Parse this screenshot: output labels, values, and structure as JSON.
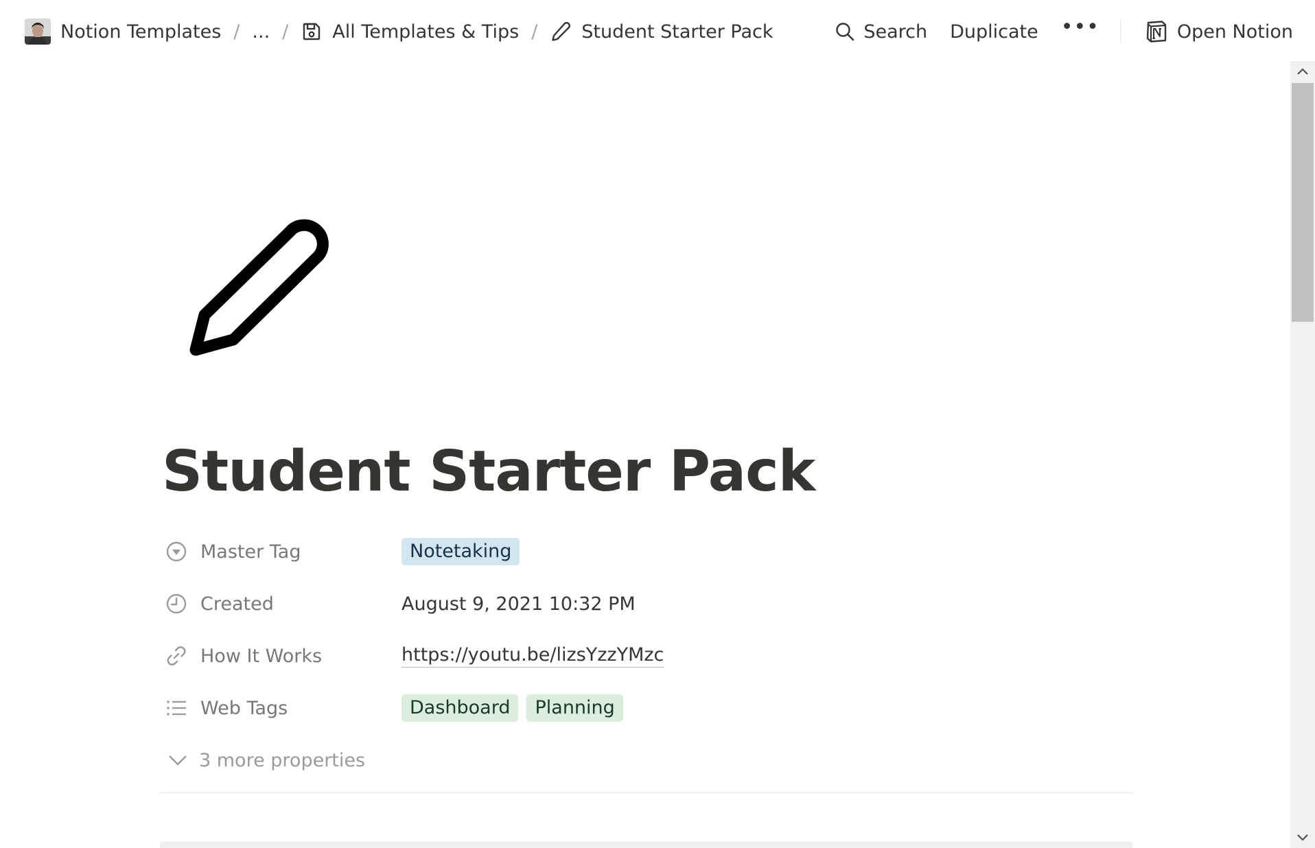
{
  "breadcrumb": {
    "workspace": "Notion Templates",
    "ellipsis": "...",
    "separator": "/",
    "parent": "All Templates & Tips",
    "current": "Student Starter Pack"
  },
  "actions": {
    "search": "Search",
    "duplicate": "Duplicate",
    "more": "•••",
    "open_notion": "Open Notion"
  },
  "page": {
    "icon": "pencil-icon",
    "title": "Student Starter Pack"
  },
  "properties": {
    "master_tag": {
      "label": "Master Tag",
      "icon": "select-icon",
      "value": "Notetaking"
    },
    "created": {
      "label": "Created",
      "icon": "clock-icon",
      "value": "August 9, 2021 10:32 PM"
    },
    "how_it_works": {
      "label": "How It Works",
      "icon": "link-icon",
      "value": "https://youtu.be/lizsYzzYMzc"
    },
    "web_tags": {
      "label": "Web Tags",
      "icon": "list-icon",
      "values": [
        "Dashboard",
        "Planning"
      ]
    },
    "more": "3 more properties"
  },
  "colors": {
    "text": "#37352f",
    "muted": "#787774",
    "tag_blue": "#d3e5ef",
    "tag_green": "#dbeddb"
  }
}
